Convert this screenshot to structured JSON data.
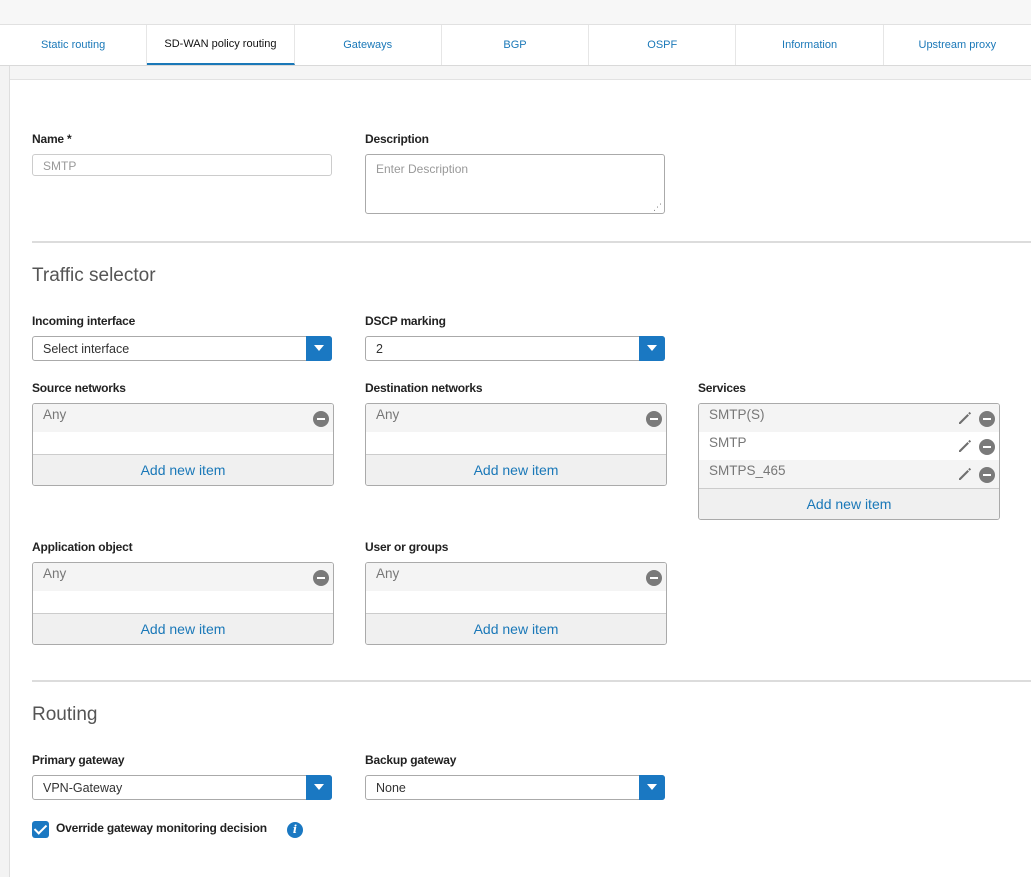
{
  "tabs": [
    "Static routing",
    "SD-WAN policy routing",
    "Gateways",
    "BGP",
    "OSPF",
    "Information",
    "Upstream proxy"
  ],
  "form": {
    "name_label": "Name *",
    "name_value": "SMTP",
    "description_label": "Description",
    "description_placeholder": "Enter Description"
  },
  "traffic_selector": {
    "title": "Traffic selector",
    "incoming_interface_label": "Incoming interface",
    "incoming_interface_value": "Select interface",
    "dscp_label": "DSCP marking",
    "dscp_value": "2",
    "source_networks_label": "Source networks",
    "source_networks_items": [
      "Any"
    ],
    "destination_networks_label": "Destination networks",
    "destination_networks_items": [
      "Any"
    ],
    "services_label": "Services",
    "services_items": [
      "SMTP(S)",
      "SMTP",
      "SMTPS_465"
    ],
    "application_object_label": "Application object",
    "application_object_items": [
      "Any"
    ],
    "user_groups_label": "User or groups",
    "user_groups_items": [
      "Any"
    ],
    "add_new_item": "Add new item"
  },
  "routing": {
    "title": "Routing",
    "primary_gateway_label": "Primary gateway",
    "primary_gateway_value": "VPN-Gateway",
    "backup_gateway_label": "Backup gateway",
    "backup_gateway_value": "None",
    "override_label": "Override gateway monitoring decision",
    "override_checked": true,
    "info_glyph": "i"
  },
  "colors": {
    "accent": "#1a78c2",
    "link": "#1a78b8"
  },
  "icons": [
    "pencil-icon",
    "minus-circle-icon",
    "chevron-down-icon",
    "check-icon",
    "info-icon"
  ]
}
